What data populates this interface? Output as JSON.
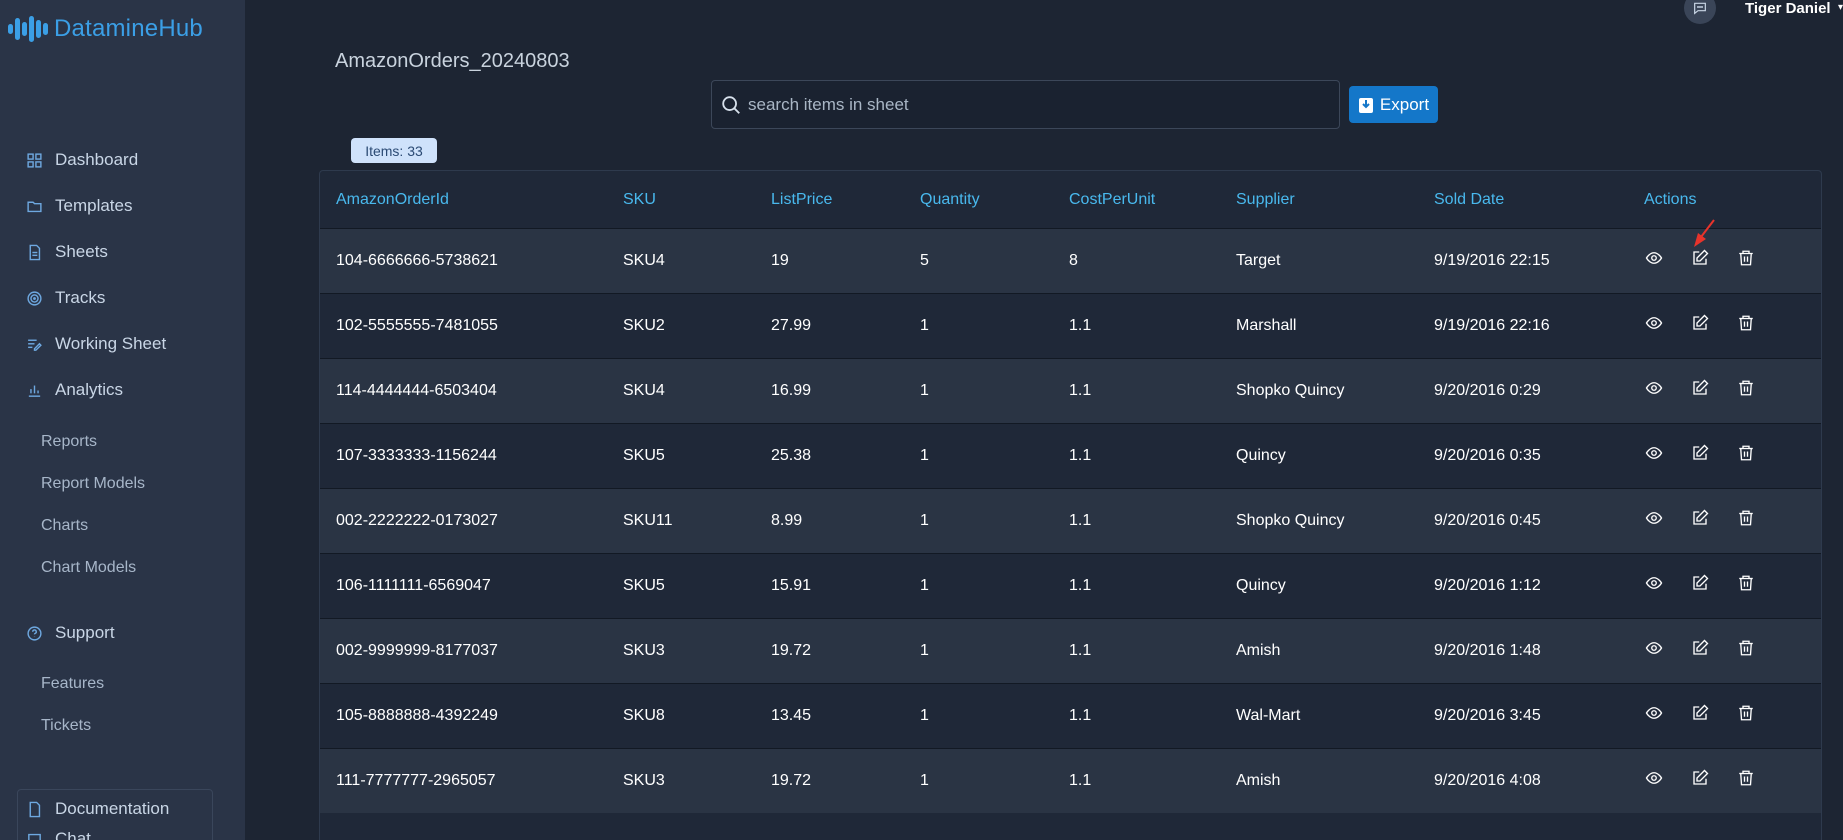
{
  "app": {
    "name": "DatamineHub"
  },
  "sidebar": {
    "items": [
      {
        "label": "Dashboard",
        "icon": "grid-icon"
      },
      {
        "label": "Templates",
        "icon": "folder-icon"
      },
      {
        "label": "Sheets",
        "icon": "file-icon"
      },
      {
        "label": "Tracks",
        "icon": "target-icon"
      },
      {
        "label": "Working Sheet",
        "icon": "edit-list-icon"
      },
      {
        "label": "Analytics",
        "icon": "bar-chart-icon"
      }
    ],
    "analytics_sub": [
      "Reports",
      "Report Models",
      "Charts",
      "Chart Models"
    ],
    "support": {
      "label": "Support",
      "icon": "help-circle-icon"
    },
    "support_sub": [
      "Features",
      "Tickets"
    ],
    "documentation": {
      "label": "Documentation",
      "icon": "file-icon"
    },
    "chat": {
      "label": "Chat",
      "icon": "chat-icon"
    }
  },
  "header": {
    "user_name": "Tiger Daniel"
  },
  "sheet": {
    "title": "AmazonOrders_20240803"
  },
  "search": {
    "placeholder": "search items in sheet"
  },
  "export": {
    "label": "Export"
  },
  "items_badge": "Items: 33",
  "table": {
    "columns": [
      "AmazonOrderId",
      "SKU",
      "ListPrice",
      "Quantity",
      "CostPerUnit",
      "Supplier",
      "Sold Date",
      "Actions"
    ],
    "rows": [
      [
        "104-6666666-5738621",
        "SKU4",
        "19",
        "5",
        "8",
        "Target",
        "9/19/2016 22:15"
      ],
      [
        "102-5555555-7481055",
        "SKU2",
        "27.99",
        "1",
        "1.1",
        "Marshall",
        "9/19/2016 22:16"
      ],
      [
        "114-4444444-6503404",
        "SKU4",
        "16.99",
        "1",
        "1.1",
        "Shopko Quincy",
        "9/20/2016 0:29"
      ],
      [
        "107-3333333-1156244",
        "SKU5",
        "25.38",
        "1",
        "1.1",
        "Quincy",
        "9/20/2016 0:35"
      ],
      [
        "002-2222222-0173027",
        "SKU11",
        "8.99",
        "1",
        "1.1",
        "Shopko Quincy",
        "9/20/2016 0:45"
      ],
      [
        "106-1111111-6569047",
        "SKU5",
        "15.91",
        "1",
        "1.1",
        "Quincy",
        "9/20/2016 1:12"
      ],
      [
        "002-9999999-8177037",
        "SKU3",
        "19.72",
        "1",
        "1.1",
        "Amish",
        "9/20/2016 1:48"
      ],
      [
        "105-8888888-4392249",
        "SKU8",
        "13.45",
        "1",
        "1.1",
        "Wal-Mart",
        "9/20/2016 3:45"
      ],
      [
        "111-7777777-2965057",
        "SKU3",
        "19.72",
        "1",
        "1.1",
        "Amish",
        "9/20/2016 4:08"
      ]
    ],
    "action_icons": [
      "eye-icon",
      "edit-icon",
      "trash-icon"
    ]
  },
  "colors": {
    "accent": "#1477c9",
    "header_text": "#49b9ee",
    "sidebar_bg": "#2a3447",
    "page_bg": "#1d2533",
    "annotation_arrow": "#e8332b"
  }
}
